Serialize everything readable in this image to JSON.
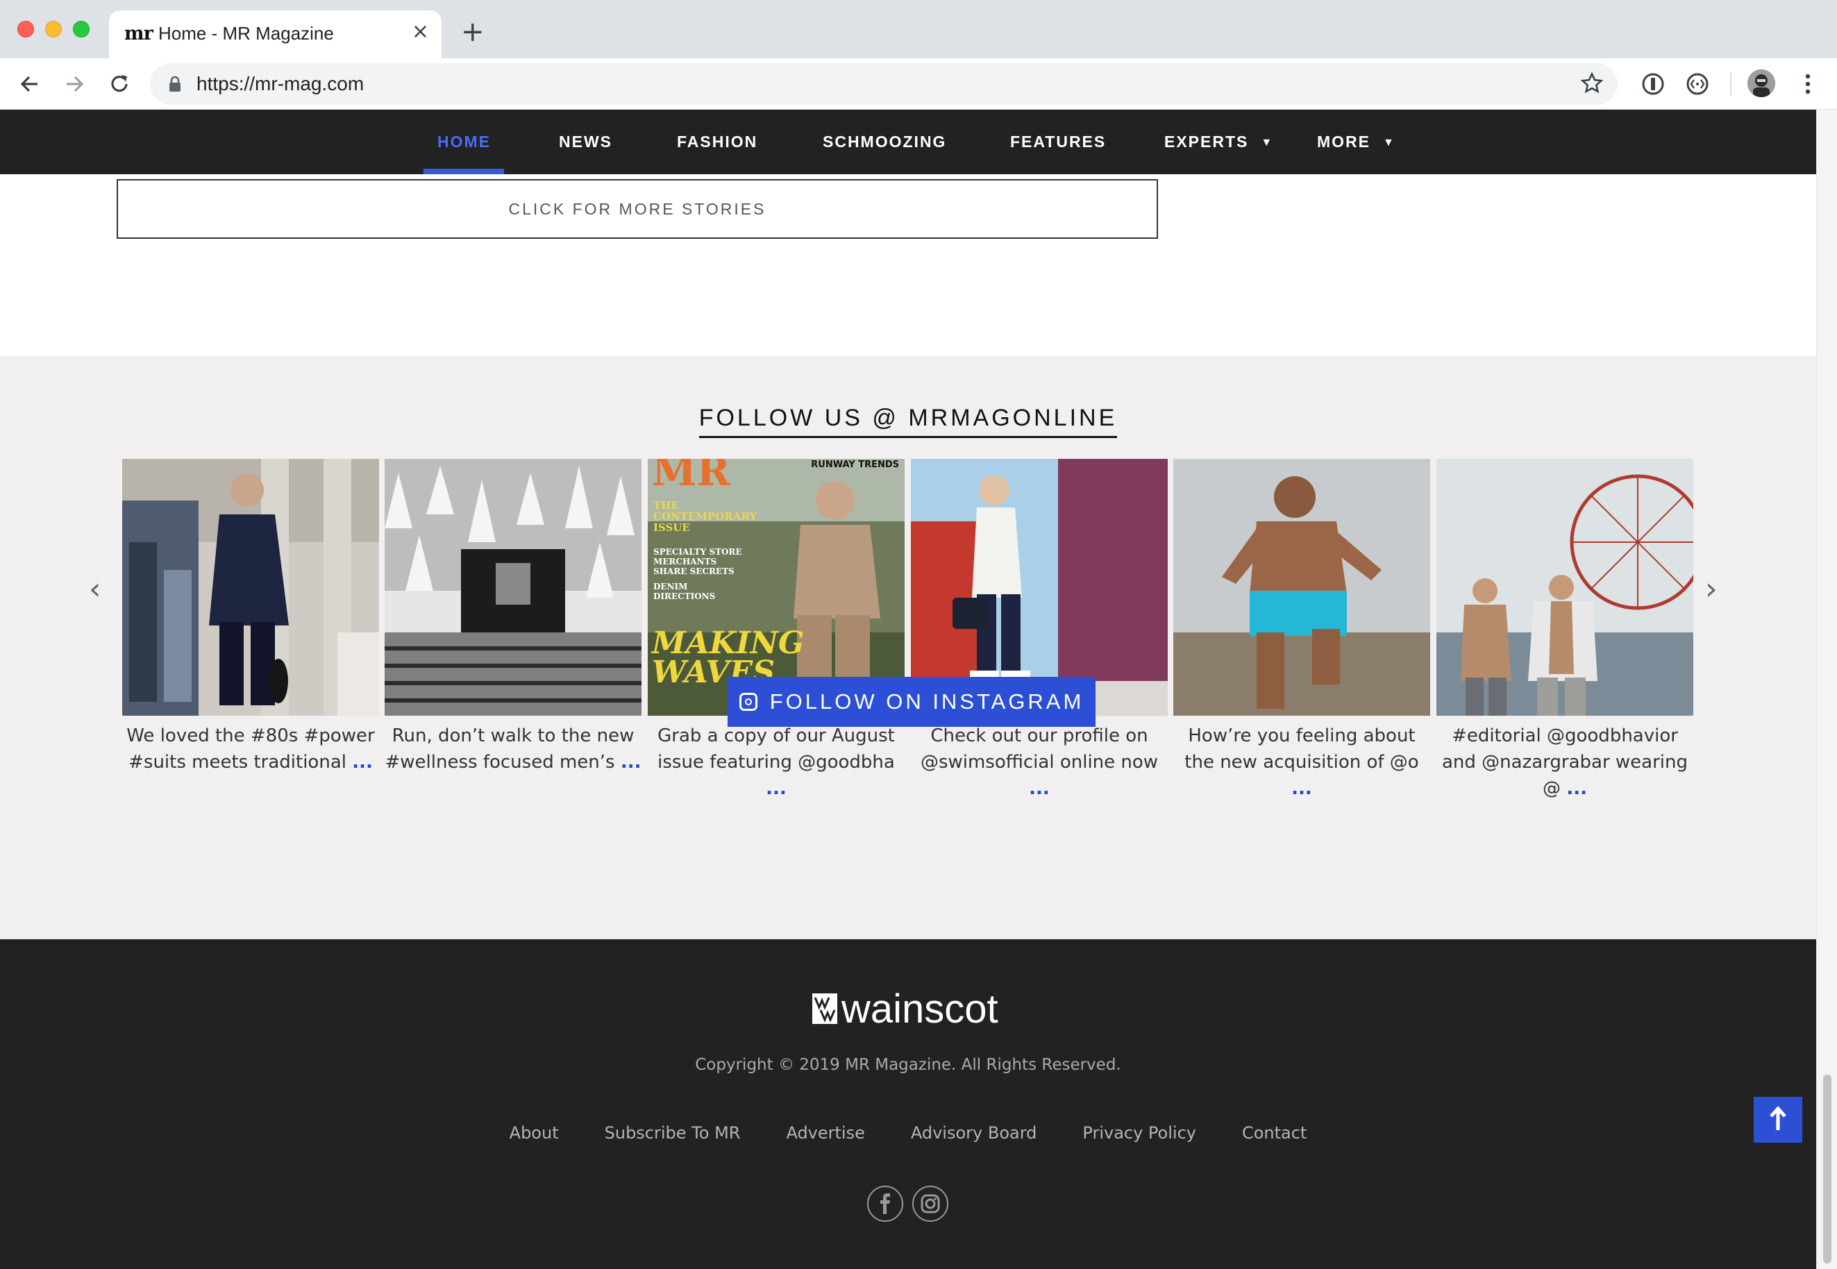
{
  "browser": {
    "tab_title": "Home - MR Magazine",
    "tab_favicon": "mr",
    "tab_close": "×",
    "new_tab": "+",
    "url": "https://mr-mag.com"
  },
  "nav": {
    "items": [
      {
        "label": "HOME"
      },
      {
        "label": "NEWS"
      },
      {
        "label": "FASHION"
      },
      {
        "label": "SCHMOOZING"
      },
      {
        "label": "FEATURES"
      },
      {
        "label": "EXPERTS"
      },
      {
        "label": "MORE"
      }
    ]
  },
  "more_stories": {
    "label": "CLICK FOR MORE STORIES"
  },
  "instagram": {
    "heading": "FOLLOW US @ MRMAGONLINE",
    "posts": [
      {
        "caption": "We loved the #80s #power #suits meets traditional",
        "more": "..."
      },
      {
        "caption": "Run, don’t walk to the new #wellness focused men’s",
        "more": "..."
      },
      {
        "caption": "Grab a copy of our August issue featuring @goodbha",
        "more": "...",
        "cover_title": "MR",
        "cover_corner": "RUNWAY TRENDS",
        "cover_lines": [
          "THE",
          "CONTEMPORARY",
          "ISSUE",
          "SPECIALTY STORE",
          "MERCHANTS",
          "SHARE SECRETS",
          "DENIM",
          "DIRECTIONS"
        ],
        "cover_headline": [
          "MAKING",
          "WAVES"
        ]
      },
      {
        "caption": "Check out our profile on @swimsofficial online now",
        "more": "..."
      },
      {
        "caption": "How’re you feeling about the new acquisition of @o",
        "more": "..."
      },
      {
        "caption": "#editorial @goodbhavior and @nazargrabar wearing @",
        "more": "..."
      }
    ],
    "prev_icon": "‹",
    "next_icon": "›",
    "follow_button": "FOLLOW ON INSTAGRAM"
  },
  "footer": {
    "logo_text": "wainscot",
    "copyright": "Copyright © 2019 MR Magazine. All Rights Reserved.",
    "links": [
      "About",
      "Subscribe To MR",
      "Advertise",
      "Advisory Board",
      "Privacy Policy",
      "Contact"
    ]
  },
  "colors": {
    "nav_bg": "#222222",
    "accent": "#2c4fd6",
    "section_bg": "#f1eff0"
  }
}
